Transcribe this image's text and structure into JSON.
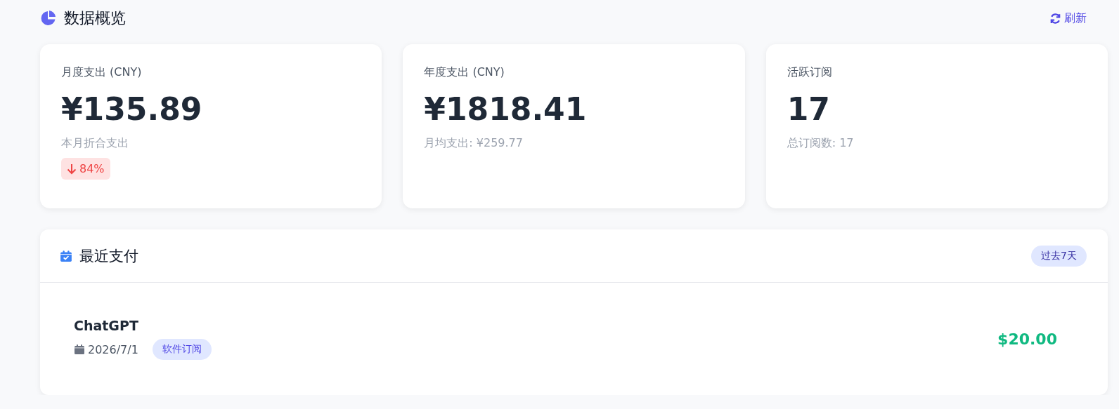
{
  "header": {
    "title": "数据概览",
    "refresh_label": "刷新"
  },
  "stats": [
    {
      "label": "月度支出 (CNY)",
      "value": "¥135.89",
      "note": "本月折合支出",
      "trend": {
        "down": true,
        "text": "84%"
      }
    },
    {
      "label": "年度支出 (CNY)",
      "value": "¥1818.41",
      "note": "月均支出: ¥259.77"
    },
    {
      "label": "活跃订阅",
      "value": "17",
      "note": "总订阅数: 17"
    }
  ],
  "recent_payments": {
    "title": "最近支付",
    "range_badge": "过去7天",
    "items": [
      {
        "name": "ChatGPT",
        "date": "2026/7/1",
        "category": "软件订阅",
        "amount": "$20.00"
      }
    ]
  }
}
